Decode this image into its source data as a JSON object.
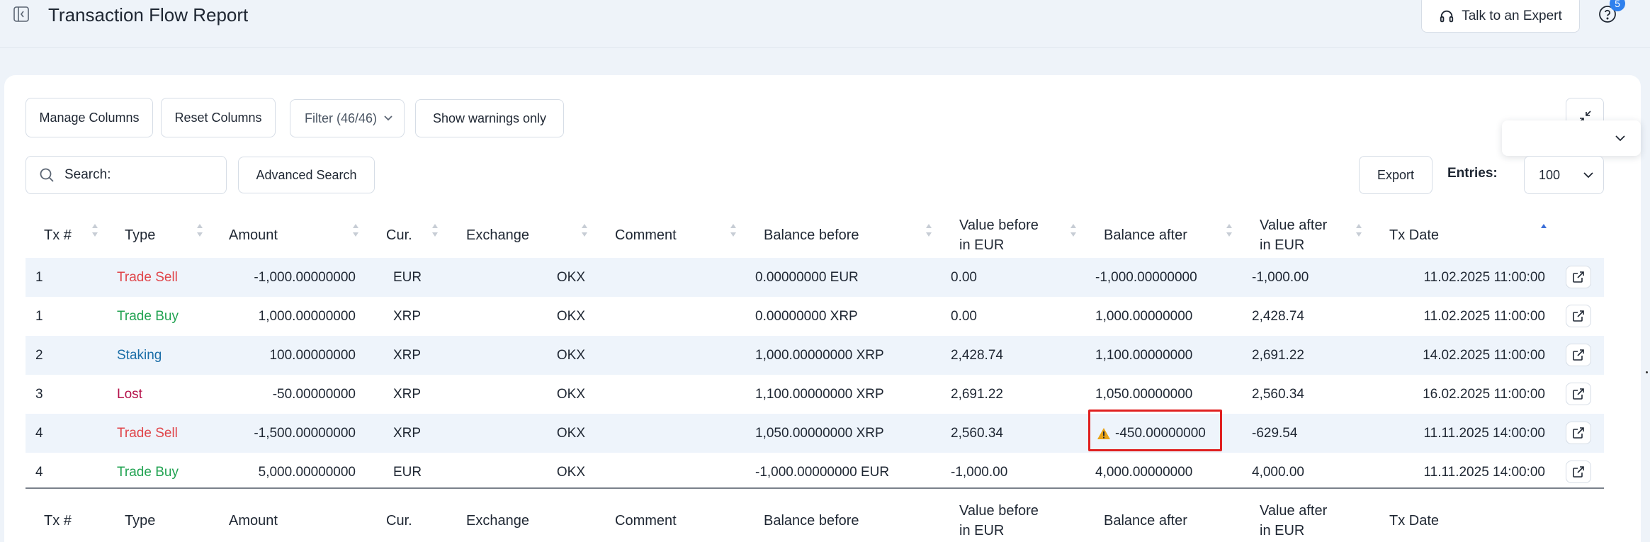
{
  "header": {
    "title": "Transaction Flow Report",
    "expert_label": "Talk to an Expert",
    "help_badge": "5"
  },
  "toolbar": {
    "manage_columns": "Manage Columns",
    "reset_columns": "Reset Columns",
    "filter_label": "Filter (46/46)",
    "show_warnings": "Show warnings only",
    "search_placeholder": "Search:",
    "advanced_search": "Advanced Search",
    "export": "Export",
    "entries_label": "Entries:",
    "entries_value": "100"
  },
  "columns": {
    "tx": "Tx #",
    "type": "Type",
    "amount": "Amount",
    "cur": "Cur.",
    "exchange": "Exchange",
    "comment": "Comment",
    "balance_before": "Balance before",
    "value_before_1": "Value before",
    "value_before_2": "in EUR",
    "balance_after": "Balance after",
    "value_after_1": "Value after",
    "value_after_2": "in EUR",
    "tx_date": "Tx Date"
  },
  "rows": [
    {
      "tx": "1",
      "type": "Trade Sell",
      "amount": "-1,000.00000000",
      "cur": "EUR",
      "exchange": "OKX",
      "comment": "",
      "balance_before": "0.00000000 EUR",
      "value_before": "0.00",
      "balance_after": "-1,000.00000000",
      "value_after": "-1,000.00",
      "date": "11.02.2025 11:00:00"
    },
    {
      "tx": "1",
      "type": "Trade Buy",
      "amount": "1,000.00000000",
      "cur": "XRP",
      "exchange": "OKX",
      "comment": "",
      "balance_before": "0.00000000 XRP",
      "value_before": "0.00",
      "balance_after": "1,000.00000000",
      "value_after": "2,428.74",
      "date": "11.02.2025 11:00:00"
    },
    {
      "tx": "2",
      "type": "Staking",
      "amount": "100.00000000",
      "cur": "XRP",
      "exchange": "OKX",
      "comment": "",
      "balance_before": "1,000.00000000 XRP",
      "value_before": "2,428.74",
      "balance_after": "1,100.00000000",
      "value_after": "2,691.22",
      "date": "14.02.2025 11:00:00"
    },
    {
      "tx": "3",
      "type": "Lost",
      "amount": "-50.00000000",
      "cur": "XRP",
      "exchange": "OKX",
      "comment": "",
      "balance_before": "1,100.00000000 XRP",
      "value_before": "2,691.22",
      "balance_after": "1,050.00000000",
      "value_after": "2,560.34",
      "date": "16.02.2025 11:00:00"
    },
    {
      "tx": "4",
      "type": "Trade Sell",
      "amount": "-1,500.00000000",
      "cur": "XRP",
      "exchange": "OKX",
      "comment": "",
      "balance_before": "1,050.00000000 XRP",
      "value_before": "2,560.34",
      "balance_after": "-450.00000000",
      "value_after": "-629.54",
      "date": "11.11.2025 14:00:00"
    },
    {
      "tx": "4",
      "type": "Trade Buy",
      "amount": "5,000.00000000",
      "cur": "EUR",
      "exchange": "OKX",
      "comment": "",
      "balance_before": "-1,000.00000000 EUR",
      "value_before": "-1,000.00",
      "balance_after": "4,000.00000000",
      "value_after": "4,000.00",
      "date": "11.11.2025 14:00:00"
    }
  ],
  "type_colors": {
    "Trade Sell": "#e0454a",
    "Trade Buy": "#22a352",
    "Staking": "#1b6ea8",
    "Lost": "#b5124a"
  },
  "warning": {
    "row_index": 4,
    "icon": "warning-icon",
    "box_color": "#e02020"
  }
}
